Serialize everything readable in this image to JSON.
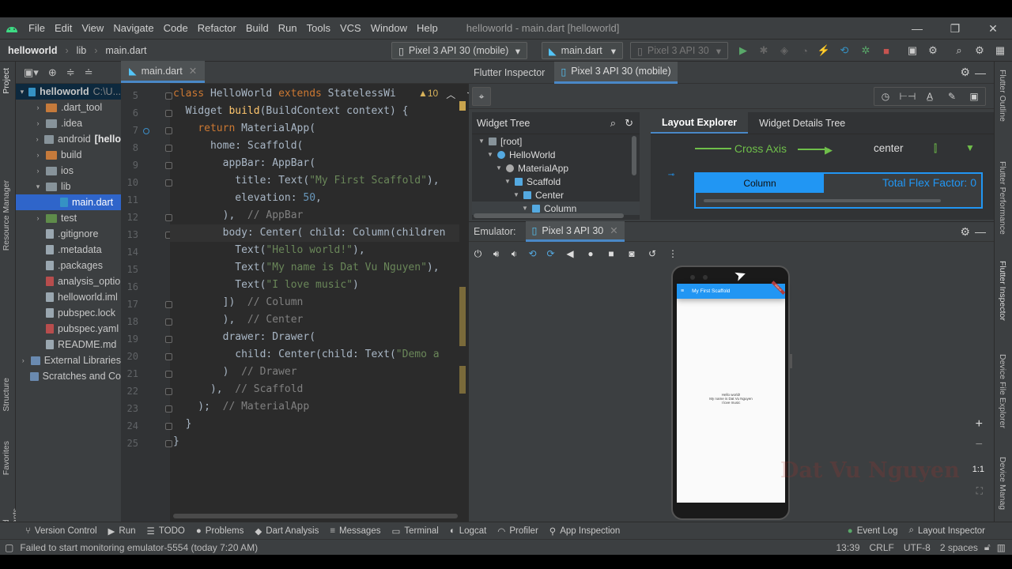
{
  "window": {
    "title": "helloworld - main.dart [helloworld]",
    "menu": [
      "File",
      "Edit",
      "View",
      "Navigate",
      "Code",
      "Refactor",
      "Build",
      "Run",
      "Tools",
      "VCS",
      "Window",
      "Help"
    ]
  },
  "navbar": {
    "project": "helloworld",
    "folder": "lib",
    "file": "main.dart",
    "device_combo": "Pixel 3 API 30 (mobile)",
    "run_config": "main.dart",
    "emulator_combo": "Pixel 3 API 30"
  },
  "project_tree": {
    "rows": [
      {
        "label": "helloworld",
        "suffix": "C:\\U...",
        "arrow": "▾",
        "indent": 0,
        "icon": "module",
        "bold": true
      },
      {
        "label": ".dart_tool",
        "arrow": "›",
        "indent": 1,
        "icon": "orange-folder"
      },
      {
        "label": ".idea",
        "arrow": "›",
        "indent": 1,
        "icon": "folder"
      },
      {
        "label": "android",
        "suffix": "[hello",
        "arrow": "›",
        "indent": 1,
        "icon": "folder"
      },
      {
        "label": "build",
        "arrow": "›",
        "indent": 1,
        "icon": "orange-folder"
      },
      {
        "label": "ios",
        "arrow": "›",
        "indent": 1,
        "icon": "folder"
      },
      {
        "label": "lib",
        "arrow": "▾",
        "indent": 1,
        "icon": "folder"
      },
      {
        "label": "main.dart",
        "arrow": "",
        "indent": 2,
        "icon": "dart"
      },
      {
        "label": "test",
        "arrow": "›",
        "indent": 1,
        "icon": "green-folder"
      },
      {
        "label": ".gitignore",
        "arrow": "",
        "indent": 1,
        "icon": "file"
      },
      {
        "label": ".metadata",
        "arrow": "",
        "indent": 1,
        "icon": "file"
      },
      {
        "label": ".packages",
        "arrow": "",
        "indent": 1,
        "icon": "file"
      },
      {
        "label": "analysis_optio",
        "arrow": "",
        "indent": 1,
        "icon": "yaml"
      },
      {
        "label": "helloworld.iml",
        "arrow": "",
        "indent": 1,
        "icon": "file"
      },
      {
        "label": "pubspec.lock",
        "arrow": "",
        "indent": 1,
        "icon": "file"
      },
      {
        "label": "pubspec.yaml",
        "arrow": "",
        "indent": 1,
        "icon": "yaml"
      },
      {
        "label": "README.md",
        "arrow": "",
        "indent": 1,
        "icon": "file"
      },
      {
        "label": "External Libraries",
        "arrow": "›",
        "indent": 0,
        "icon": "lib"
      },
      {
        "label": "Scratches and Co",
        "arrow": "",
        "indent": 0,
        "icon": "scratch"
      }
    ]
  },
  "left_strip": {
    "project": "Project",
    "resource_manager": "Resource Manager",
    "structure": "Structure",
    "favorites": "Favorites",
    "build_variants": "Build Variants"
  },
  "editor": {
    "tab": "main.dart",
    "warnings": "▲10",
    "line_numbers": [
      "5",
      "6",
      "7",
      "8",
      "9",
      "10",
      "11",
      "12",
      "13",
      "14",
      "15",
      "16",
      "17",
      "18",
      "19",
      "20",
      "21",
      "22",
      "23",
      "24",
      "25"
    ]
  },
  "inspector": {
    "tab_flutter_inspector": "Flutter Inspector",
    "tab_device": "Pixel 3 API 30 (mobile)",
    "widget_tree_title": "Widget Tree",
    "widget_tree": [
      "[root]",
      "HelloWorld",
      "MaterialApp",
      "Scaffold",
      "Center",
      "Column"
    ],
    "layout_explorer": "Layout Explorer",
    "widget_details_tree": "Widget Details Tree",
    "cross_axis": "Cross Axis",
    "cross_axis_value": "center",
    "column_label": "Column",
    "total_flex": "Total Flex Factor: 0"
  },
  "emulator": {
    "label": "Emulator:",
    "tab": "Pixel 3 API 30",
    "app_title": "My First Scaffold",
    "debug_badge": "DEBUG",
    "lines": [
      "Hello world!",
      "My name is Dat Vu Nguyen",
      "I love music"
    ],
    "zoom_ratio": "1:1",
    "watermark": "Dat Vu Nguyen"
  },
  "right_strip": {
    "outline": "Flutter Outline",
    "performance": "Flutter Performance",
    "inspector": "Flutter Inspector",
    "device_file": "Device File Explorer",
    "device_manager": "Device Manag"
  },
  "bottom_tools": [
    "Version Control",
    "Run",
    "TODO",
    "Problems",
    "Dart Analysis",
    "Messages",
    "Terminal",
    "Logcat",
    "Profiler",
    "App Inspection"
  ],
  "bottom_right_tools": [
    "Event Log",
    "Layout Inspector"
  ],
  "status": {
    "message": "Failed to start monitoring emulator-5554 (today 7:20 AM)",
    "position": "13:39",
    "line_sep": "CRLF",
    "encoding": "UTF-8",
    "indent": "2 spaces"
  },
  "colors": {
    "accent": "#4a88c7",
    "selection": "#2f65ca",
    "flutter_blue": "#2196f3",
    "layout_green": "#6fbf4a"
  }
}
